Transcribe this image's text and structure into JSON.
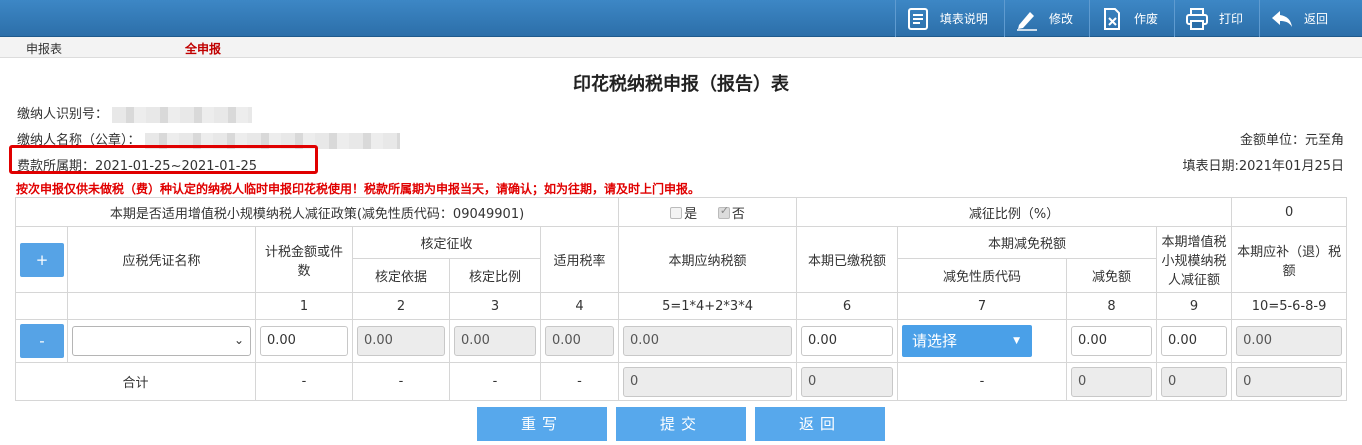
{
  "toolbar": {
    "items": [
      {
        "label": "填表说明",
        "icon": "document-list-icon"
      },
      {
        "label": "修改",
        "icon": "pencil-icon"
      },
      {
        "label": "作废",
        "icon": "void-document-icon"
      },
      {
        "label": "打印",
        "icon": "printer-icon"
      },
      {
        "label": "返回",
        "icon": "back-arrow-icon"
      }
    ]
  },
  "subnav": {
    "left": "申报表",
    "active": "全申报"
  },
  "form": {
    "title": "印花税纳税申报（报告）表",
    "taxpayer_id_label": "缴纳人识别号：",
    "taxpayer_name_label": "缴纳人名称（公章）：",
    "period_label": "费款所属期：",
    "period_value": "2021-01-25~2021-01-25",
    "currency_unit": "金额单位：元至角",
    "fill_date": "填表日期:2021年01月25日",
    "warning": "按次申报仅供未做税（费）种认定的纳税人临时申报印花税使用！税款所属期为申报当天，请确认；如为往期，请及时上门申报。"
  },
  "table": {
    "policy_text": "本期是否适用增值税小规模纳税人减征政策(减免性质代码：09049901)",
    "yes_label": "是",
    "no_label": "否",
    "yes_checked": false,
    "no_checked": true,
    "reduction_ratio_label": "减征比例（%）",
    "reduction_ratio_value": "0",
    "add_label": "+",
    "remove_label": "-",
    "headers": {
      "voucher_name": "应税凭证名称",
      "taxable_amount": "计税金额或件数",
      "assessed_levy": "核定征收",
      "assessed_basis": "核定依据",
      "assessed_ratio": "核定比例",
      "tax_rate": "适用税率",
      "tax_payable": "本期应纳税额",
      "tax_paid": "本期已缴税额",
      "tax_relief": "本期减免税额",
      "relief_code": "减免性质代码",
      "relief_amount": "减免额",
      "vat_small_reduction": "本期增值税小规模纳税人减征额",
      "tax_due": "本期应补（退）税额"
    },
    "col_numbers": [
      "1",
      "2",
      "3",
      "4",
      "5=1*4+2*3*4",
      "6",
      "7",
      "8",
      "9",
      "10=5-6-8-9"
    ],
    "row": {
      "voucher_select": "",
      "taxable_amount": "0.00",
      "assessed_basis": "0.00",
      "assessed_ratio": "0.00",
      "tax_rate": "0.00",
      "tax_payable": "0.00",
      "tax_paid": "0.00",
      "relief_code_select": "请选择",
      "relief_amount": "0.00",
      "vat_small_reduction": "0.00",
      "tax_due": "0.00"
    },
    "total": {
      "label": "合计",
      "dash": "-",
      "tax_payable": "0",
      "tax_paid": "0",
      "relief_amount": "0",
      "vat_small_reduction": "0",
      "tax_due": "0"
    }
  },
  "buttons": {
    "reset": "重写",
    "submit": "提交",
    "back": "返回"
  }
}
